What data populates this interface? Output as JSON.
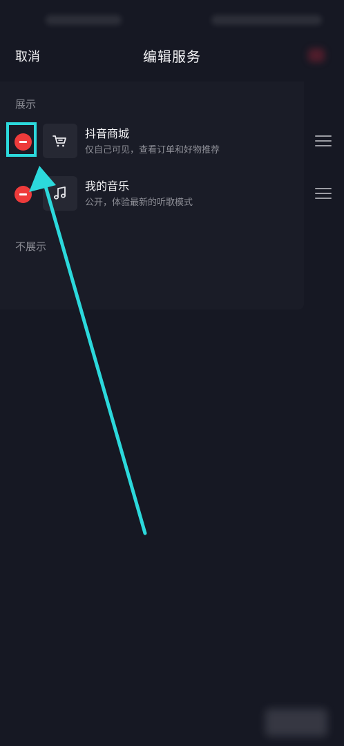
{
  "header": {
    "cancel_label": "取消",
    "title": "编辑服务"
  },
  "sections": {
    "shown_label": "展示",
    "hidden_label": "不展示"
  },
  "services": [
    {
      "title": "抖音商城",
      "subtitle": "仅自己可见，查看订单和好物推荐",
      "icon": "shopping-cart-icon"
    },
    {
      "title": "我的音乐",
      "subtitle": "公开，体验最新的听歌模式",
      "icon": "music-note-icon"
    }
  ],
  "colors": {
    "background": "#161823",
    "remove_button": "#ee3b3b",
    "annotation": "#2cd9dc"
  }
}
